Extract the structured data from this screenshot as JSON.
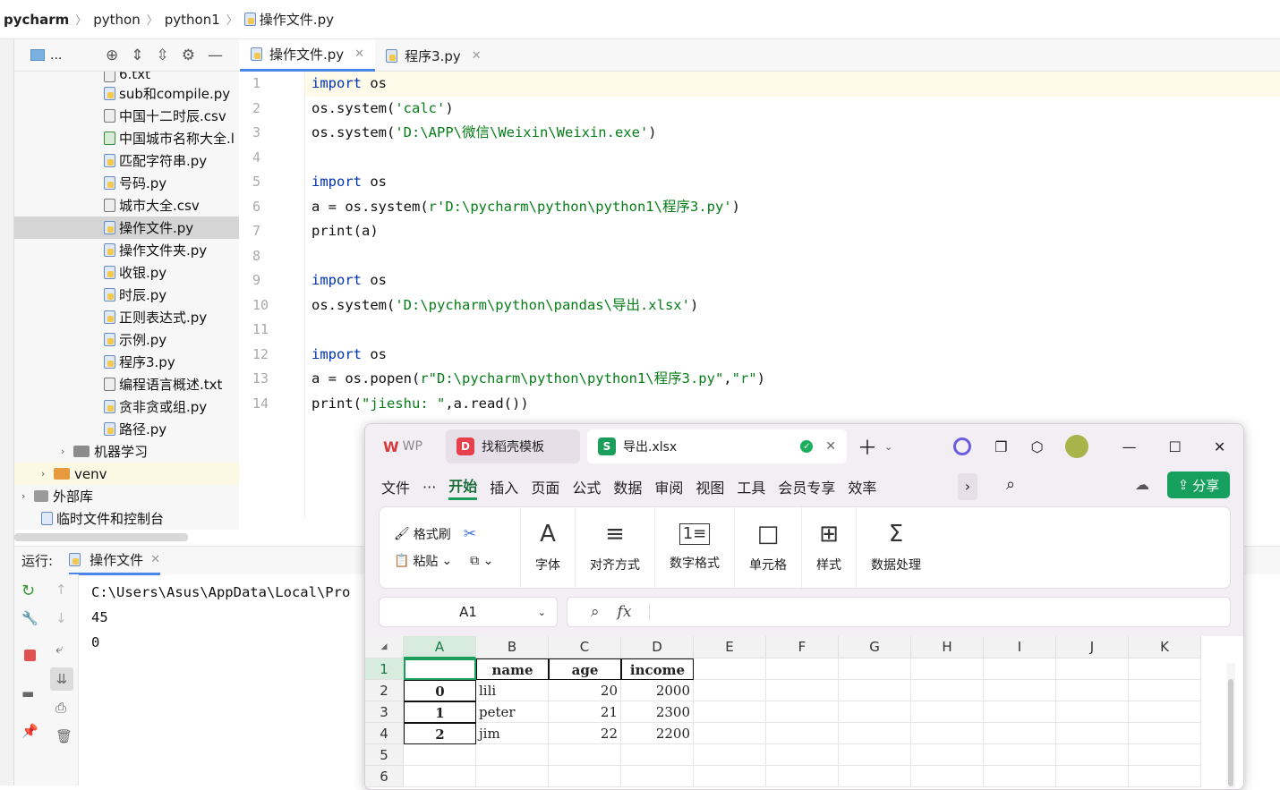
{
  "breadcrumb": {
    "items": [
      "pycharm",
      "python",
      "python1",
      "操作文件.py"
    ]
  },
  "project_panel": {
    "title": "...",
    "tree": [
      {
        "label": "6.txt",
        "type": "txt",
        "indent": 1
      },
      {
        "label": "sub和compile.py",
        "type": "py",
        "indent": 1
      },
      {
        "label": "中国十二时辰.csv",
        "type": "csv",
        "indent": 1
      },
      {
        "label": "中国城市名称大全.l",
        "type": "xl",
        "indent": 1
      },
      {
        "label": "匹配字符串.py",
        "type": "py",
        "indent": 1
      },
      {
        "label": "号码.py",
        "type": "py",
        "indent": 1
      },
      {
        "label": "城市大全.csv",
        "type": "csv",
        "indent": 1
      },
      {
        "label": "操作文件.py",
        "type": "py",
        "indent": 1,
        "selected": true
      },
      {
        "label": "操作文件夹.py",
        "type": "py",
        "indent": 1
      },
      {
        "label": "收银.py",
        "type": "py",
        "indent": 1
      },
      {
        "label": "时辰.py",
        "type": "py",
        "indent": 1
      },
      {
        "label": "正则表达式.py",
        "type": "py",
        "indent": 1
      },
      {
        "label": "示例.py",
        "type": "py",
        "indent": 1
      },
      {
        "label": "程序3.py",
        "type": "py",
        "indent": 1
      },
      {
        "label": "编程语言概述.txt",
        "type": "txt",
        "indent": 1
      },
      {
        "label": "贪非贪或组.py",
        "type": "py",
        "indent": 1
      },
      {
        "label": "路径.py",
        "type": "py",
        "indent": 1
      },
      {
        "label": "机器学习",
        "type": "folder",
        "indent": 2
      },
      {
        "label": "venv",
        "type": "folder-orange",
        "indent": 3
      },
      {
        "label": "外部库",
        "type": "lib",
        "indent": 4
      },
      {
        "label": "临时文件和控制台",
        "type": "scratch",
        "indent": 5
      }
    ]
  },
  "editor": {
    "tabs": [
      {
        "label": "操作文件.py",
        "active": true
      },
      {
        "label": "程序3.py",
        "active": false
      }
    ],
    "lines": [
      [
        {
          "t": "import",
          "c": "kw"
        },
        {
          "t": " os"
        }
      ],
      [
        {
          "t": "os.system("
        },
        {
          "t": "'calc'",
          "c": "st"
        },
        {
          "t": ")"
        }
      ],
      [
        {
          "t": "os.system("
        },
        {
          "t": "'D:\\APP\\微信\\Weixin\\Weixin.exe'",
          "c": "st"
        },
        {
          "t": ")"
        }
      ],
      [],
      [
        {
          "t": "import",
          "c": "kw"
        },
        {
          "t": " os"
        }
      ],
      [
        {
          "t": "a = os.system("
        },
        {
          "t": "r'D:\\pycharm\\python\\python1\\程序3.py'",
          "c": "st"
        },
        {
          "t": ")"
        }
      ],
      [
        {
          "t": "print(a)"
        }
      ],
      [],
      [
        {
          "t": "import",
          "c": "kw"
        },
        {
          "t": " os"
        }
      ],
      [
        {
          "t": "os.system("
        },
        {
          "t": "'D:\\pycharm\\python\\pandas\\导出.xlsx'",
          "c": "st"
        },
        {
          "t": ")"
        }
      ],
      [],
      [
        {
          "t": "import",
          "c": "kw"
        },
        {
          "t": " os"
        }
      ],
      [
        {
          "t": "a = os.popen("
        },
        {
          "t": "r\"D:\\pycharm\\python\\python1\\程序3.py\"",
          "c": "st"
        },
        {
          "t": ","
        },
        {
          "t": "\"r\"",
          "c": "st"
        },
        {
          "t": ")"
        }
      ],
      [
        {
          "t": "print("
        },
        {
          "t": "\"jieshu: \"",
          "c": "st"
        },
        {
          "t": ",a.read())"
        }
      ]
    ]
  },
  "run": {
    "label": "运行:",
    "tab": "操作文件",
    "output": [
      "C:\\Users\\Asus\\AppData\\Local\\Pro",
      "45",
      "0"
    ]
  },
  "wps": {
    "tabs": {
      "wps": "WP",
      "template": "找稻壳模板",
      "doc": "导出.xlsx"
    },
    "menu": [
      "文件",
      "···",
      "开始",
      "插入",
      "页面",
      "公式",
      "数据",
      "审阅",
      "视图",
      "工具",
      "会员专享",
      "效率"
    ],
    "active_menu": "开始",
    "share": "分享",
    "ribbon": {
      "format_painter": "格式刷",
      "paste": "粘贴",
      "font": "字体",
      "align": "对齐方式",
      "number": "数字格式",
      "cell": "单元格",
      "style": "样式",
      "data": "数据处理"
    },
    "name_box": "A1",
    "fx": "fx",
    "columns": [
      "A",
      "B",
      "C",
      "D",
      "E",
      "F",
      "G",
      "H",
      "I",
      "J",
      "K"
    ],
    "rows": [
      "1",
      "2",
      "3",
      "4",
      "5",
      "6"
    ],
    "cells": {
      "r1": [
        "",
        "name",
        "age",
        "income"
      ],
      "r2": [
        "0",
        "lili",
        "20",
        "2000"
      ],
      "r3": [
        "1",
        "peter",
        "21",
        "2300"
      ],
      "r4": [
        "2",
        "jim",
        "22",
        "2200"
      ]
    }
  }
}
